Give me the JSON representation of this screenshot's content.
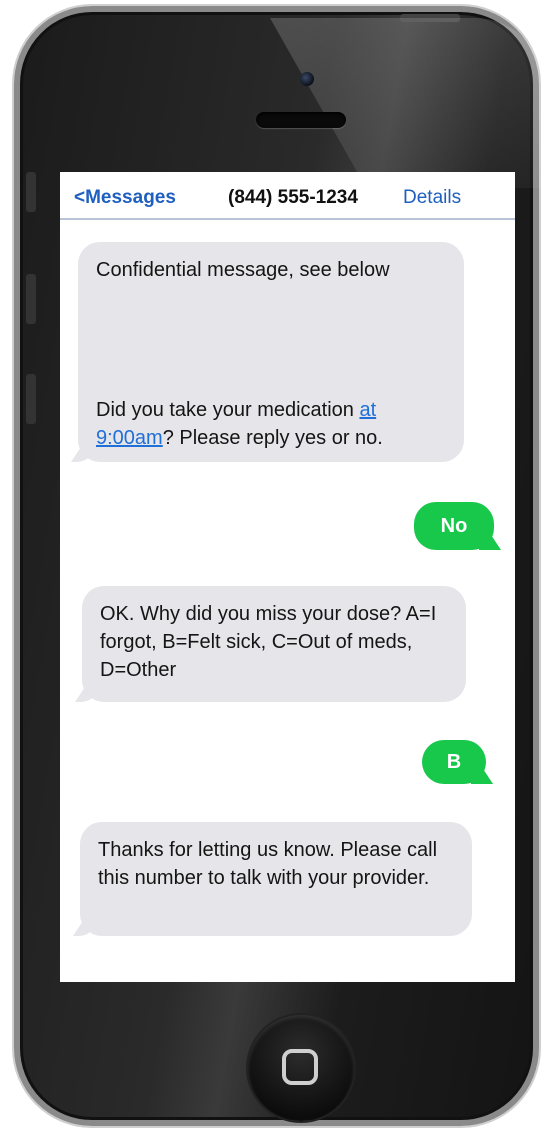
{
  "navbar": {
    "back_label": "<Messages",
    "contact": "(844) 555-1234",
    "details_label": "Details"
  },
  "messages": [
    {
      "direction": "incoming",
      "line1": "Confidential message, see below",
      "line2_prefix": "Did you take your medication ",
      "line2_link": "at 9:00am",
      "line2_suffix": "? Please reply yes or no."
    },
    {
      "direction": "outgoing",
      "text": "No"
    },
    {
      "direction": "incoming",
      "text": "OK. Why did you miss your dose? A=I forgot, B=Felt sick, C=Out of meds, D=Other"
    },
    {
      "direction": "outgoing",
      "text": "B"
    },
    {
      "direction": "incoming",
      "text": "Thanks for letting us know. Please call this number to talk with your provider."
    }
  ],
  "colors": {
    "incoming_bubble": "#e5e5ea",
    "outgoing_bubble": "#17c84a",
    "link_blue": "#1f6fd8",
    "nav_blue": "#1f5fbf"
  },
  "icons": {
    "home_button": "home-square-icon",
    "camera": "camera-icon",
    "speaker": "speaker-icon"
  }
}
